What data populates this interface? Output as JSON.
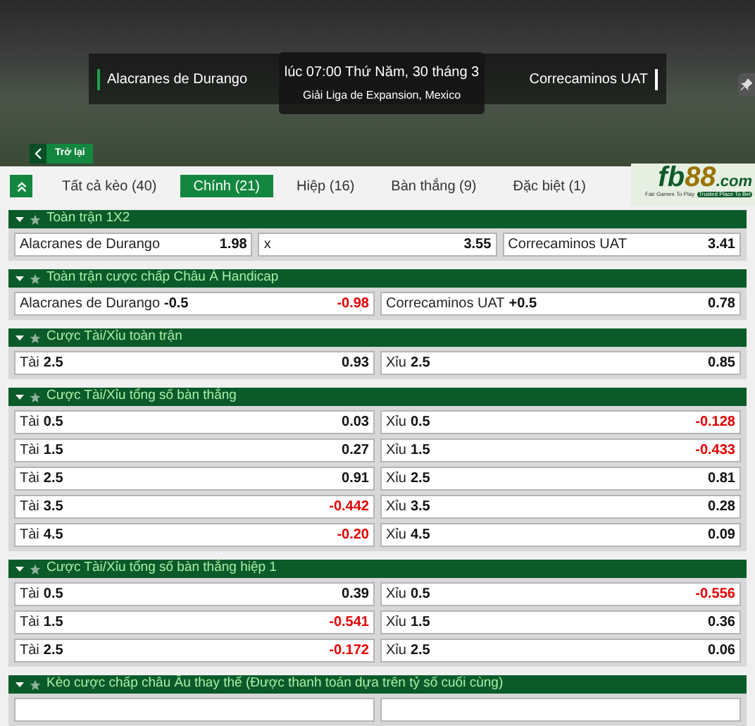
{
  "match": {
    "home": "Alacranes de Durango",
    "away": "Correcaminos UAT",
    "time": "lúc 07:00 Thứ Năm, 30 tháng 3",
    "league": "Giải Liga de Expansion, Mexico"
  },
  "back_button": {
    "label": "Trở lại"
  },
  "tabs": [
    {
      "label": "Tất cả kèo (40)",
      "selected": false
    },
    {
      "label": "Chính (21)",
      "selected": true
    },
    {
      "label": "Hiệp (16)",
      "selected": false
    },
    {
      "label": "Bàn thắng (9)",
      "selected": false
    },
    {
      "label": "Đặc biệt (1)",
      "selected": false
    }
  ],
  "logo": {
    "name_1": "fb",
    "name_2": "88",
    "domain": ".com",
    "tagline_1": "Fair Games To Play",
    "tagline_2": "Trusted Place To Bet"
  },
  "sections": [
    {
      "title": "Toàn trận 1X2",
      "expanded": true,
      "rows": [
        {
          "cells": [
            {
              "label": "Alacranes de Durango",
              "odds": "1.98",
              "negative": false
            },
            {
              "label": "x",
              "odds": "3.55",
              "negative": false
            },
            {
              "label": "Correcaminos UAT",
              "odds": "3.41",
              "negative": false
            }
          ]
        }
      ]
    },
    {
      "title": "Toàn trận cược chấp Châu Á Handicap",
      "expanded": true,
      "rows": [
        {
          "cells": [
            {
              "label": "Alacranes de Durango",
              "line": "-0.5",
              "odds": "-0.98",
              "negative": true
            },
            {
              "label": "Correcaminos UAT",
              "line": "+0.5",
              "odds": "0.78",
              "negative": false
            }
          ]
        }
      ]
    },
    {
      "title": "Cược Tài/Xỉu toàn trận",
      "expanded": true,
      "rows": [
        {
          "cells": [
            {
              "label": "Tài",
              "line": "2.5",
              "odds": "0.93",
              "negative": false
            },
            {
              "label": "Xỉu",
              "line": "2.5",
              "odds": "0.85",
              "negative": false
            }
          ]
        }
      ]
    },
    {
      "title": "Cược Tài/Xỉu tổng số bàn thắng",
      "expanded": true,
      "rows": [
        {
          "cells": [
            {
              "label": "Tài",
              "line": "0.5",
              "odds": "0.03",
              "negative": false
            },
            {
              "label": "Xỉu",
              "line": "0.5",
              "odds": "-0.128",
              "negative": true
            }
          ]
        },
        {
          "cells": [
            {
              "label": "Tài",
              "line": "1.5",
              "odds": "0.27",
              "negative": false
            },
            {
              "label": "Xỉu",
              "line": "1.5",
              "odds": "-0.433",
              "negative": true
            }
          ]
        },
        {
          "cells": [
            {
              "label": "Tài",
              "line": "2.5",
              "odds": "0.91",
              "negative": false
            },
            {
              "label": "Xỉu",
              "line": "2.5",
              "odds": "0.81",
              "negative": false
            }
          ]
        },
        {
          "cells": [
            {
              "label": "Tài",
              "line": "3.5",
              "odds": "-0.442",
              "negative": true
            },
            {
              "label": "Xỉu",
              "line": "3.5",
              "odds": "0.28",
              "negative": false
            }
          ]
        },
        {
          "cells": [
            {
              "label": "Tài",
              "line": "4.5",
              "odds": "-0.20",
              "negative": true
            },
            {
              "label": "Xỉu",
              "line": "4.5",
              "odds": "0.09",
              "negative": false
            }
          ]
        }
      ]
    },
    {
      "title": "Cược Tài/Xỉu tổng số bàn thắng hiệp 1",
      "expanded": true,
      "rows": [
        {
          "cells": [
            {
              "label": "Tài",
              "line": "0.5",
              "odds": "0.39",
              "negative": false
            },
            {
              "label": "Xỉu",
              "line": "0.5",
              "odds": "-0.556",
              "negative": true
            }
          ]
        },
        {
          "cells": [
            {
              "label": "Tài",
              "line": "1.5",
              "odds": "-0.541",
              "negative": true
            },
            {
              "label": "Xỉu",
              "line": "1.5",
              "odds": "0.36",
              "negative": false
            }
          ]
        },
        {
          "cells": [
            {
              "label": "Tài",
              "line": "2.5",
              "odds": "-0.172",
              "negative": true
            },
            {
              "label": "Xỉu",
              "line": "2.5",
              "odds": "0.06",
              "negative": false
            }
          ]
        }
      ]
    },
    {
      "title": "Kèo cược chấp châu Âu thay thế (Được thanh toán dựa trên tỷ số cuối cùng)",
      "expanded": true,
      "rows": [
        {
          "cells": [
            {},
            {}
          ]
        }
      ]
    }
  ]
}
